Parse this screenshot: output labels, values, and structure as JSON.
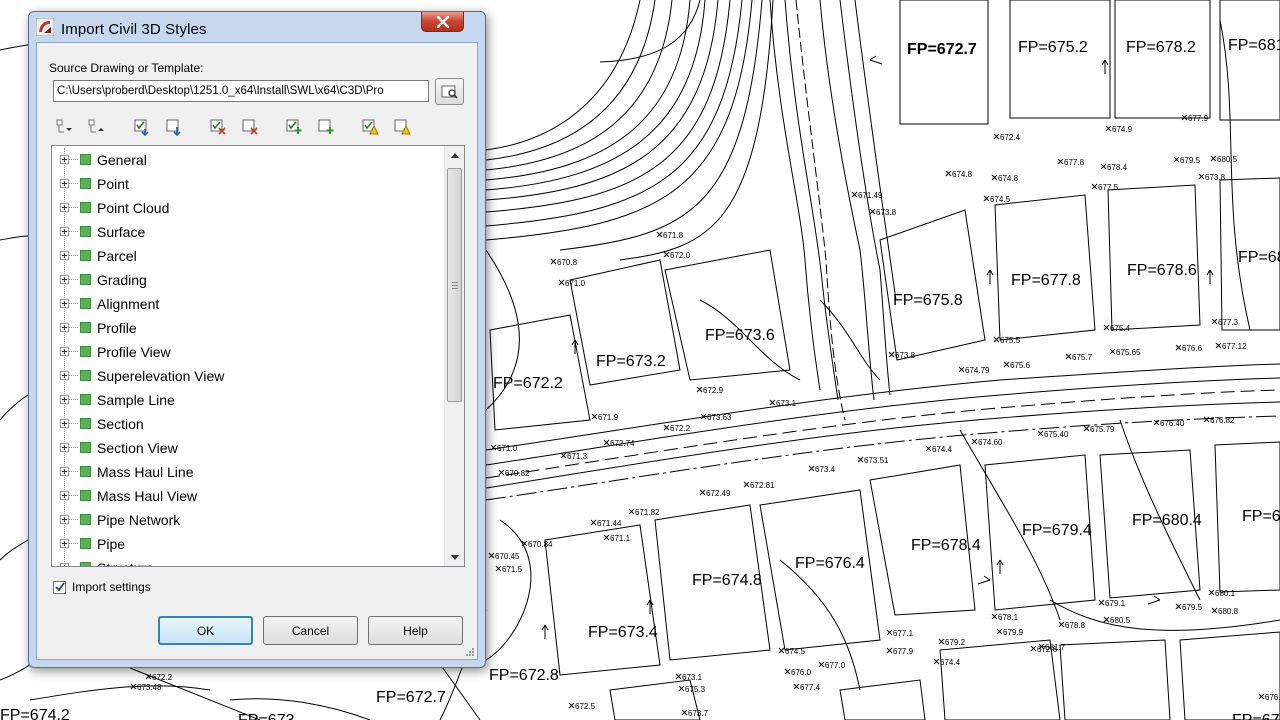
{
  "cad": {
    "fp_labels": [
      {
        "text": "FP=672.7"
      },
      {
        "text": "FP=675.2"
      },
      {
        "text": "FP=678.2"
      },
      {
        "text": "FP=681"
      },
      {
        "text": "FP=675.8"
      },
      {
        "text": "FP=677.8"
      },
      {
        "text": "FP=678.6"
      },
      {
        "text": "FP=68"
      },
      {
        "text": "FP=673.6"
      },
      {
        "text": "FP=673.2"
      },
      {
        "text": "FP=672.2"
      },
      {
        "text": "FP=676.4"
      },
      {
        "text": "FP=674.8"
      },
      {
        "text": "FP=678.4"
      },
      {
        "text": "FP=679.4"
      },
      {
        "text": "FP=680.4"
      },
      {
        "text": "FP=6"
      },
      {
        "text": "FP=673.4"
      },
      {
        "text": "FP=672.8"
      },
      {
        "text": "FP=672.7"
      },
      {
        "text": "FP=674.2"
      },
      {
        "text": "FP=673"
      },
      {
        "text": "FP=67"
      }
    ],
    "elev_labels": [
      "672.4",
      "674.9",
      "677.9",
      "677.8",
      "678.4",
      "679.5",
      "680.5",
      "673.8",
      "674.8",
      "674.8",
      "674.5",
      "677.5",
      "671.49",
      "673.8",
      "671.8",
      "672.0",
      "670.8",
      "671.0",
      "673.8",
      "674.79",
      "675.5",
      "675.6",
      "675.7",
      "675.65",
      "676.6",
      "677.12",
      "677.3",
      "675.4",
      "672.9",
      "673.1",
      "671.9",
      "673.63",
      "672.2",
      "672.74",
      "671.0",
      "671.3",
      "670.82",
      "673.4",
      "673.51",
      "674.4",
      "674.60",
      "675.40",
      "675.79",
      "676.40",
      "676.82",
      "672.49",
      "672.81",
      "671.82",
      "671.44",
      "671.1",
      "670.84",
      "670.45",
      "671.5",
      "677.1",
      "677.9",
      "679.2",
      "678.1",
      "679.9",
      "680.5",
      "679.1",
      "679.5",
      "680.8",
      "680.1",
      "674.5",
      "676.0",
      "677.0",
      "677.4",
      "673.1",
      "675.3",
      "673.7",
      "672.5",
      "672.2",
      "673.48",
      "672.6",
      "674.4",
      "676.3",
      "678.8",
      "681.7"
    ]
  },
  "dialog": {
    "title": "Import Civil 3D Styles",
    "close_glyph": "✕",
    "source_label": "Source Drawing or Template:",
    "source_path": "C:\\Users\\proberd\\Desktop\\1251.0_x64\\Install\\SWL\\x64\\C3D\\Pro",
    "tree_items": [
      "General",
      "Point",
      "Point Cloud",
      "Surface",
      "Parcel",
      "Grading",
      "Alignment",
      "Profile",
      "Profile View",
      "Superelevation View",
      "Sample Line",
      "Section",
      "Section View",
      "Mass Haul Line",
      "Mass Haul View",
      "Pipe Network",
      "Pipe",
      "Structure"
    ],
    "import_settings_label": "Import settings",
    "import_settings_checked": true,
    "buttons": {
      "ok": "OK",
      "cancel": "Cancel",
      "help": "Help"
    }
  }
}
